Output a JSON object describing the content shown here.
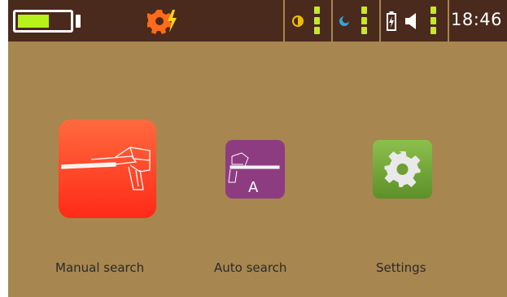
{
  "status_bar": {
    "battery_level": 0.62,
    "battery_color": "#b7f21a",
    "mode_icon": "gear-with-lightning-icon",
    "indicators": [
      {
        "icon": "sun-icon",
        "color": "#f0c000",
        "level_bars": 3
      },
      {
        "icon": "moon-icon",
        "color": "#2aa9e0",
        "level_bars": 3
      },
      {
        "icon": "battery-charge-icon",
        "color": "#ffffff",
        "level_bars": 0
      },
      {
        "icon": "speaker-icon",
        "color": "#ffffff",
        "level_bars": 3
      }
    ],
    "time": "18:46"
  },
  "menu": {
    "items": [
      {
        "label": "Manual search",
        "icon": "detector-wand-icon",
        "color": "#ff4a2a"
      },
      {
        "label": "Auto search",
        "icon": "detector-auto-icon",
        "color": "#8e3c82"
      },
      {
        "label": "Settings",
        "icon": "gear-icon",
        "color": "#7aab3c"
      }
    ]
  },
  "colors": {
    "background": "#a8864f",
    "topbar": "#4a2a1c",
    "level_bar": "#c6e82a"
  }
}
